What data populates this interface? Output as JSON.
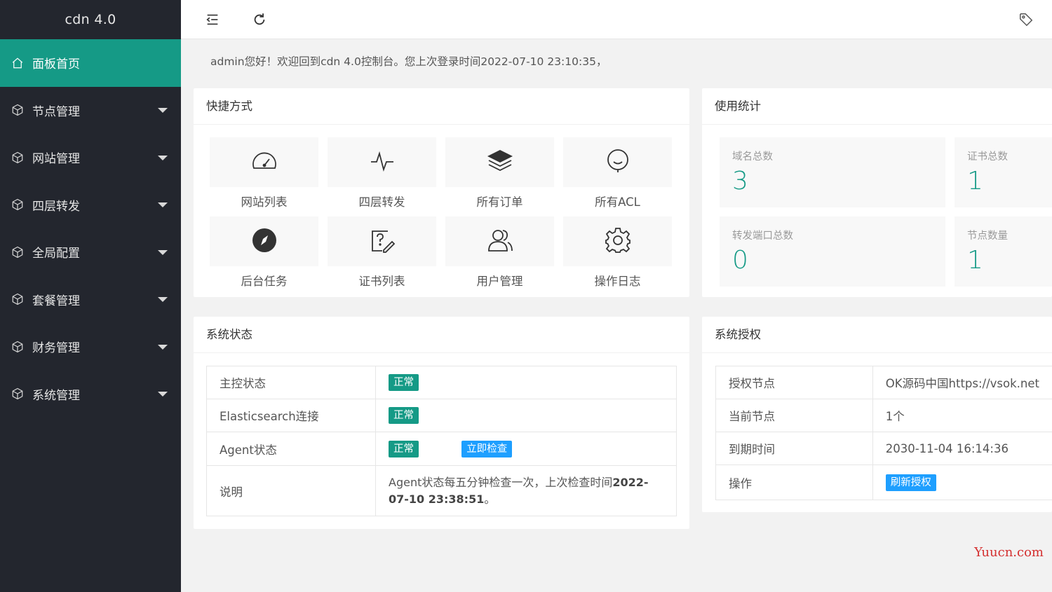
{
  "brand": "cdn 4.0",
  "sidebar": {
    "items": [
      {
        "label": "面板首页",
        "icon": "home-icon"
      },
      {
        "label": "节点管理",
        "icon": "cube-icon"
      },
      {
        "label": "网站管理",
        "icon": "cube-icon"
      },
      {
        "label": "四层转发",
        "icon": "cube-icon"
      },
      {
        "label": "全局配置",
        "icon": "cube-icon"
      },
      {
        "label": "套餐管理",
        "icon": "cube-icon"
      },
      {
        "label": "财务管理",
        "icon": "cube-icon"
      },
      {
        "label": "系统管理",
        "icon": "cube-icon"
      }
    ]
  },
  "topbar": {
    "menu_icon": "menu-fold-icon",
    "refresh_icon": "refresh-icon",
    "tag_icon": "tag-icon"
  },
  "welcome": "admin您好！欢迎回到cdn 4.0控制台。您上次登录时间2022-07-10 23:10:35，",
  "shortcuts": {
    "title": "快捷方式",
    "items": [
      {
        "label": "网站列表",
        "icon": "dashboard-gauge-icon"
      },
      {
        "label": "四层转发",
        "icon": "pulse-icon"
      },
      {
        "label": "所有订单",
        "icon": "layers-icon"
      },
      {
        "label": "所有ACL",
        "icon": "smile-chat-icon"
      },
      {
        "label": "后台任务",
        "icon": "compass-icon"
      },
      {
        "label": "证书列表",
        "icon": "question-edit-icon"
      },
      {
        "label": "用户管理",
        "icon": "users-icon"
      },
      {
        "label": "操作日志",
        "icon": "gear-icon"
      }
    ]
  },
  "usage": {
    "title": "使用统计",
    "stats": [
      {
        "label": "域名总数",
        "value": "3"
      },
      {
        "label": "证书总数",
        "value": "1"
      },
      {
        "label": "转发端口总数",
        "value": "0"
      },
      {
        "label": "节点数量",
        "value": "1"
      }
    ]
  },
  "system_status": {
    "title": "系统状态",
    "rows": [
      {
        "key": "主控状态",
        "badge": "正常"
      },
      {
        "key": "Elasticsearch连接",
        "badge": "正常"
      },
      {
        "key": "Agent状态",
        "badge": "正常",
        "action": "立即检查"
      },
      {
        "key": "说明",
        "desc_prefix": "Agent状态每五分钟检查一次，上次检查时间",
        "desc_time": "2022-07-10 23:38:51",
        "desc_suffix": "。"
      }
    ]
  },
  "license": {
    "title": "系统授权",
    "rows": [
      {
        "key": "授权节点",
        "value": "OK源码中国https://vsok.net"
      },
      {
        "key": "当前节点",
        "value": "1个"
      },
      {
        "key": "到期时间",
        "value": "2030-11-04 16:14:36"
      },
      {
        "key": "操作",
        "action": "刷新授权"
      }
    ]
  },
  "watermark": "Yuucn.com",
  "colors": {
    "accent": "#159a86",
    "sidebar": "#23262e",
    "info_blue": "#1e9fff"
  }
}
